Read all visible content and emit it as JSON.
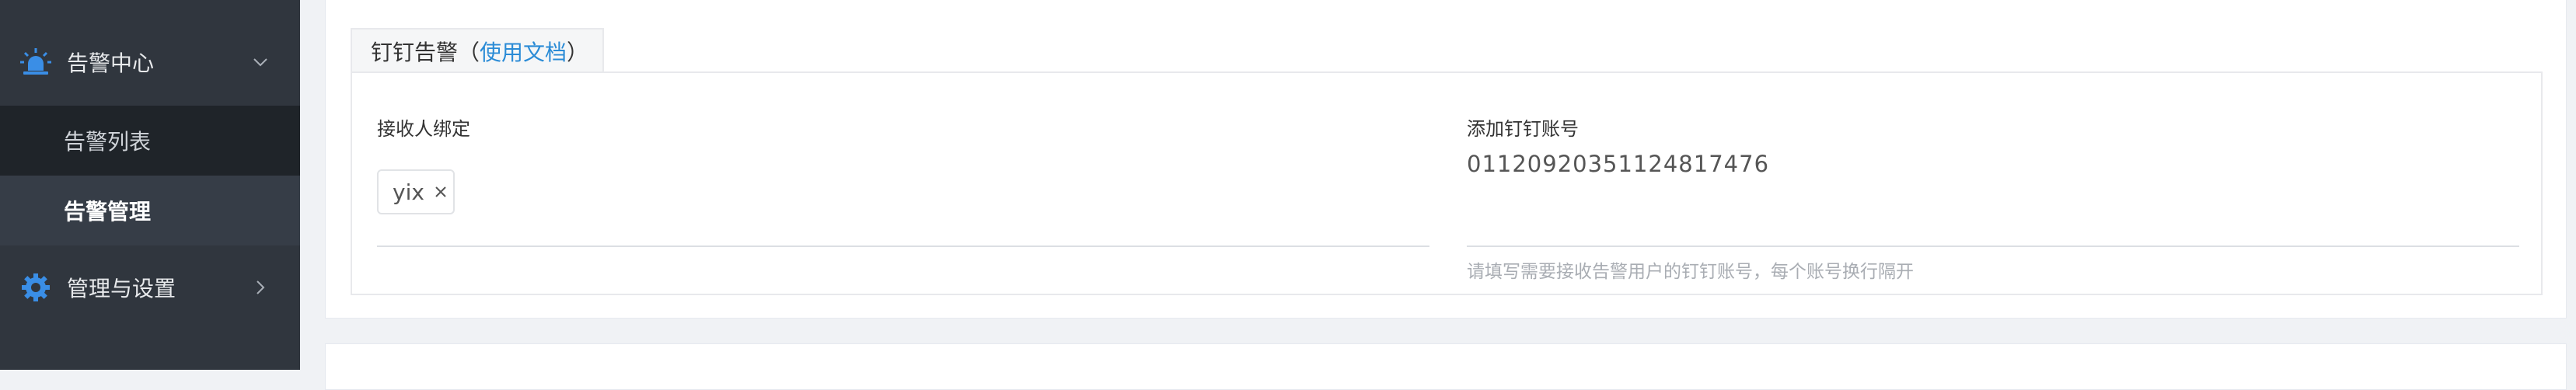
{
  "sidebar": {
    "alarm_center": {
      "label": "告警中心",
      "icon": "alarm-light-icon",
      "arrow": "chevron-down-icon"
    },
    "items": [
      {
        "label": "告警列表"
      },
      {
        "label": "告警管理"
      }
    ],
    "settings": {
      "label": "管理与设置",
      "icon": "gear-icon",
      "arrow": "chevron-right-icon"
    }
  },
  "tab": {
    "title": "钉钉告警（",
    "doc_link": "使用文档",
    "close_paren": "）"
  },
  "form": {
    "receiver_label": "接收人绑定",
    "receiver_tag": "yix",
    "account_label": "添加钉钉账号",
    "account_value": "01120920351124817476",
    "account_hint": "请填写需要接收告警用户的钉钉账号，每个账号换行隔开"
  },
  "colors": {
    "sidebar_bg": "#30363e",
    "accent": "#2a8bd6",
    "icon_blue": "#3a8ee6"
  }
}
